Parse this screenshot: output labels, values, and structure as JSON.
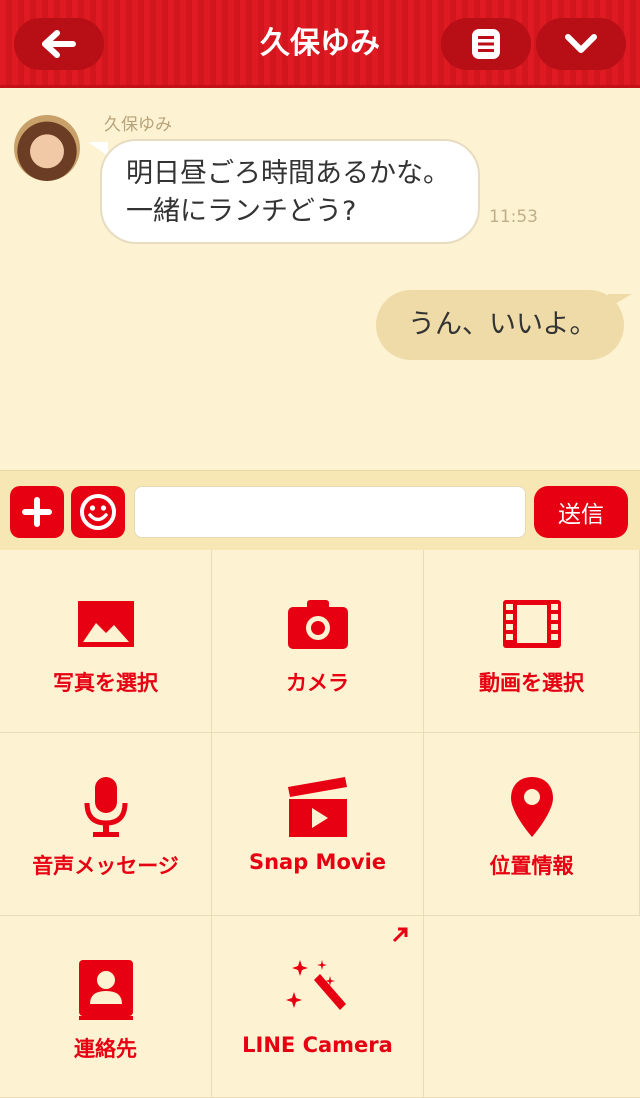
{
  "header": {
    "title": "久保ゆみ"
  },
  "messages": {
    "incoming": {
      "sender": "久保ゆみ",
      "line1": "明日昼ごろ時間あるかな。",
      "line2": "一緒にランチどう?",
      "time": "11:53"
    },
    "outgoing": {
      "text": "うん、いいよ。"
    }
  },
  "input": {
    "value": "",
    "send_label": "送信"
  },
  "menu": {
    "photo": "写真を選択",
    "camera": "カメラ",
    "video": "動画を選択",
    "voice": "音声メッセージ",
    "snap_movie": "Snap Movie",
    "location": "位置情報",
    "contact": "連絡先",
    "line_camera": "LINE Camera"
  },
  "colors": {
    "accent": "#e60012",
    "header": "#e01a22",
    "background": "#fdf3d2",
    "outgoing_bubble": "#eedba7"
  },
  "icons": [
    "back-arrow-icon",
    "note-icon",
    "chevron-down-icon",
    "plus-icon",
    "smiley-icon",
    "image-icon",
    "camera-icon",
    "film-icon",
    "microphone-icon",
    "clapperboard-icon",
    "location-pin-icon",
    "contact-book-icon",
    "magic-wand-icon",
    "external-arrow-icon"
  ]
}
